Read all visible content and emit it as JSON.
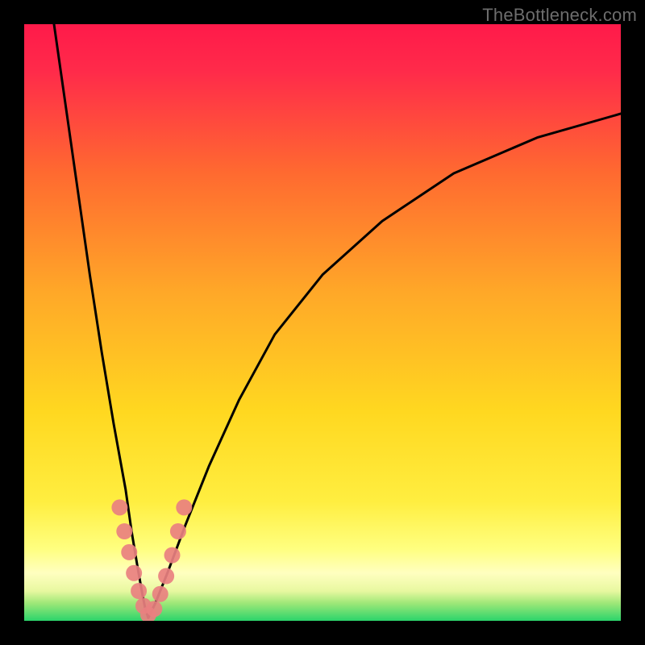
{
  "watermark": "TheBottleneck.com",
  "colors": {
    "gradient_top": "#ff1a4a",
    "gradient_mid_top": "#ff5a2b",
    "gradient_mid": "#ffcc20",
    "gradient_low": "#ffff66",
    "gradient_pale": "#ffffb0",
    "gradient_green": "#2bd46b",
    "curve": "#000000",
    "marker": "#e98080",
    "frame": "#000000"
  },
  "chart_data": {
    "type": "line",
    "title": "",
    "xlabel": "",
    "ylabel": "",
    "xlim": [
      0,
      100
    ],
    "ylim": [
      0,
      100
    ],
    "bands": [
      {
        "y0": 0,
        "y1": 3,
        "color": "#2bd46b"
      },
      {
        "y0": 3,
        "y1": 8,
        "color": "#b8e85e"
      },
      {
        "y0": 8,
        "y1": 15,
        "color": "#ffffb0"
      },
      {
        "y0": 15,
        "y1": 22,
        "color": "#ffff66"
      },
      {
        "y0": 22,
        "y1": 55,
        "color": "#ffcc20"
      },
      {
        "y0": 55,
        "y1": 80,
        "color": "#ff8a2a"
      },
      {
        "y0": 80,
        "y1": 100,
        "color": "#ff1a4a"
      }
    ],
    "series": [
      {
        "name": "left-branch",
        "x": [
          5,
          7,
          9,
          11,
          13,
          15,
          17,
          18,
          19,
          19.8,
          20.3,
          20.8
        ],
        "y": [
          100,
          86,
          72,
          58,
          45,
          33,
          22,
          15,
          9,
          4.5,
          2,
          0.5
        ]
      },
      {
        "name": "right-branch",
        "x": [
          20.8,
          22,
          24,
          27,
          31,
          36,
          42,
          50,
          60,
          72,
          86,
          100
        ],
        "y": [
          0.5,
          3,
          8,
          16,
          26,
          37,
          48,
          58,
          67,
          75,
          81,
          85
        ]
      }
    ],
    "markers": [
      {
        "x": 16.0,
        "y": 19.0
      },
      {
        "x": 16.8,
        "y": 15.0
      },
      {
        "x": 17.6,
        "y": 11.5
      },
      {
        "x": 18.4,
        "y": 8.0
      },
      {
        "x": 19.2,
        "y": 5.0
      },
      {
        "x": 20.0,
        "y": 2.5
      },
      {
        "x": 20.8,
        "y": 1.0
      },
      {
        "x": 21.8,
        "y": 2.0
      },
      {
        "x": 22.8,
        "y": 4.5
      },
      {
        "x": 23.8,
        "y": 7.5
      },
      {
        "x": 24.8,
        "y": 11.0
      },
      {
        "x": 25.8,
        "y": 15.0
      },
      {
        "x": 26.8,
        "y": 19.0
      }
    ],
    "marker_radius_px": 10
  }
}
